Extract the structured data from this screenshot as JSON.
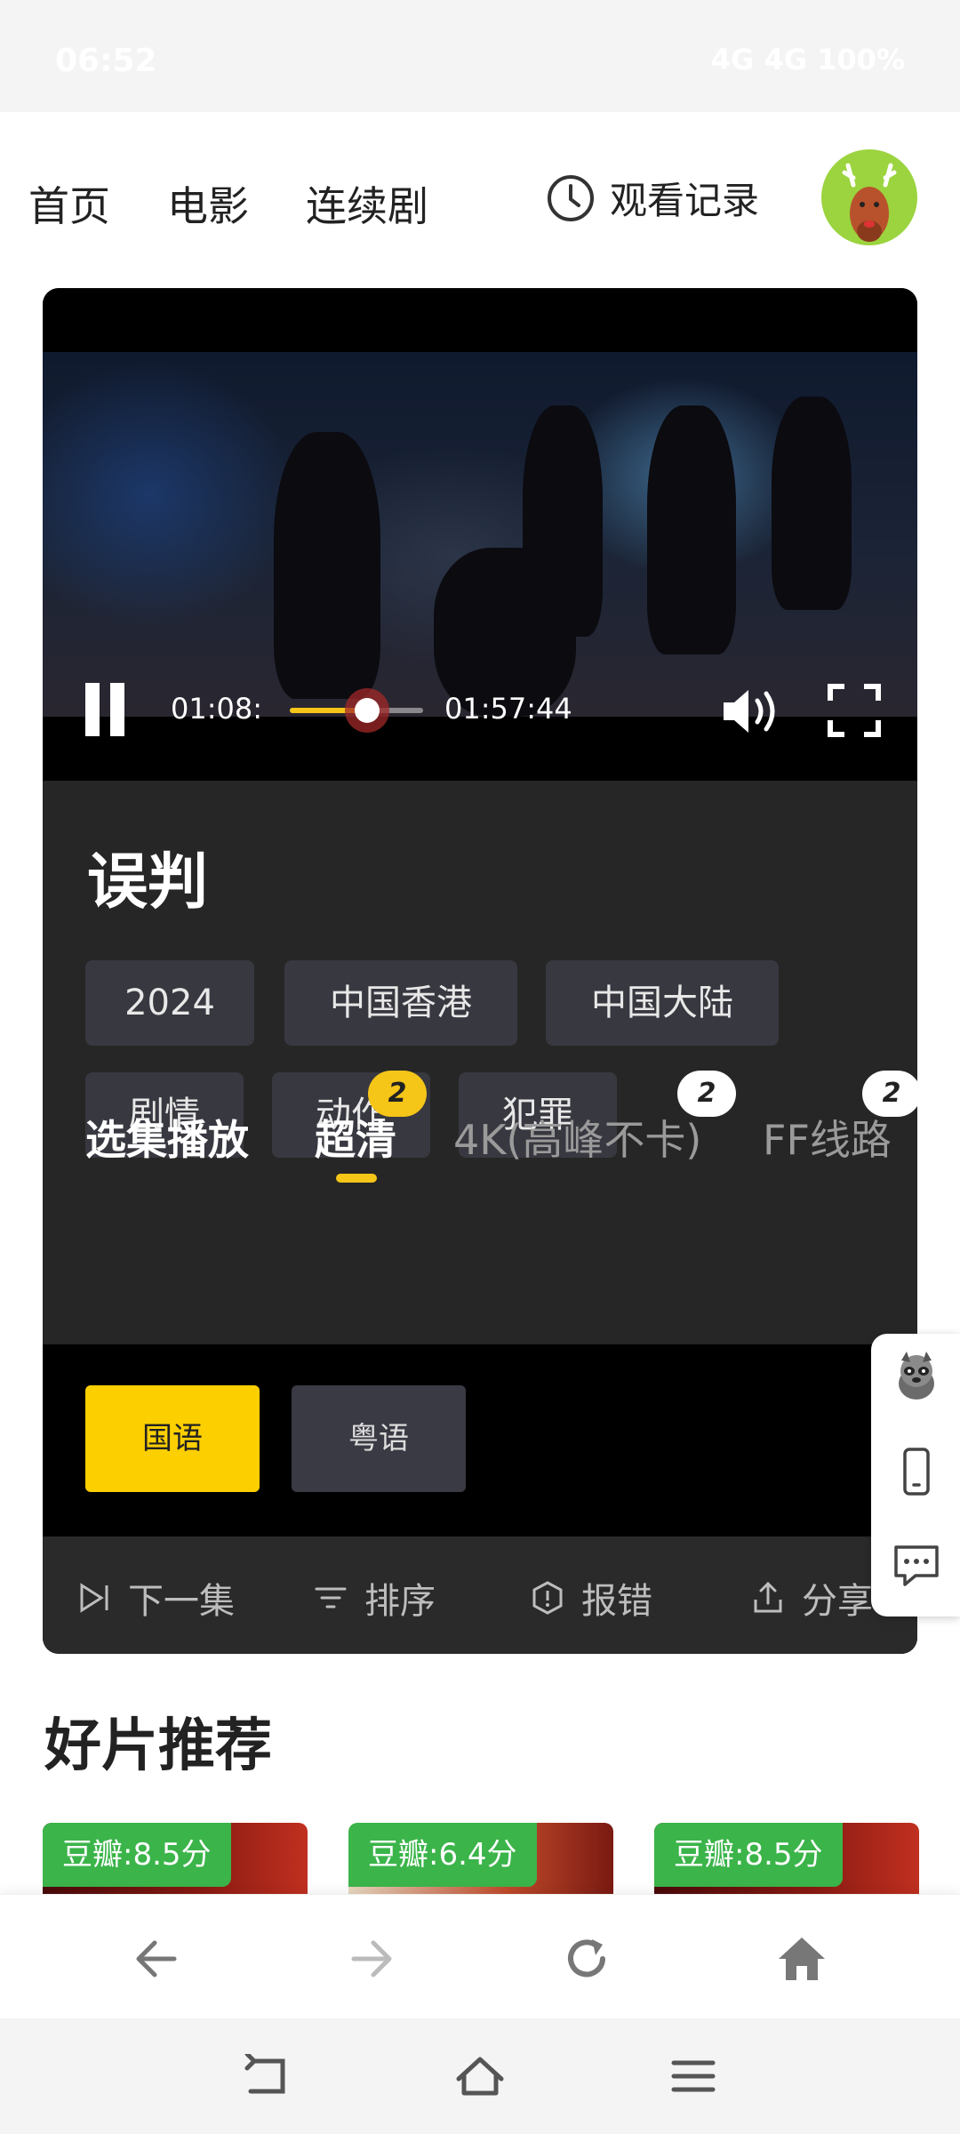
{
  "status_bar": {
    "time": "06:52",
    "system": "4G 4G 100%"
  },
  "nav": {
    "items": [
      "首页",
      "电影",
      "连续剧"
    ],
    "history_label": "观看记录",
    "history_icon": "clock-icon",
    "avatar_icon": "deer-avatar-icon"
  },
  "player": {
    "current_time": "01:08:",
    "duration": "01:57:44",
    "progress_fraction": 0.58,
    "state": "playing",
    "accent_color": "#f5c518"
  },
  "movie": {
    "title": "误判",
    "tags": [
      "2024",
      "中国香港",
      "中国大陆",
      "剧情",
      "动作",
      "犯罪"
    ]
  },
  "sources": {
    "label": "选集播放",
    "items": [
      {
        "name": "超清",
        "badge": "2",
        "active": true
      },
      {
        "name": "4K(高峰不卡)",
        "badge": "2",
        "active": false
      },
      {
        "name": "FF线路",
        "badge": "2",
        "active": false
      }
    ]
  },
  "languages": [
    {
      "label": "国语",
      "selected": true
    },
    {
      "label": "粤语",
      "selected": false
    }
  ],
  "actions": [
    {
      "label": "下一集",
      "icon": "next-episode-icon"
    },
    {
      "label": "排序",
      "icon": "sort-icon"
    },
    {
      "label": "报错",
      "icon": "report-error-icon"
    },
    {
      "label": "分享",
      "icon": "share-icon"
    }
  ],
  "side_tools": [
    "mascot-icon",
    "phone-icon",
    "chat-icon"
  ],
  "recommendations": {
    "title": "好片推荐",
    "items": [
      {
        "rating": "豆瓣:8.5分"
      },
      {
        "rating": "豆瓣:6.4分"
      },
      {
        "rating": "豆瓣:8.5分"
      }
    ]
  },
  "browser_bar": [
    "back-arrow-icon",
    "forward-arrow-icon",
    "reload-icon",
    "home-icon"
  ],
  "system_nav": [
    "back-icon",
    "home-outline-icon",
    "menu-icon"
  ]
}
